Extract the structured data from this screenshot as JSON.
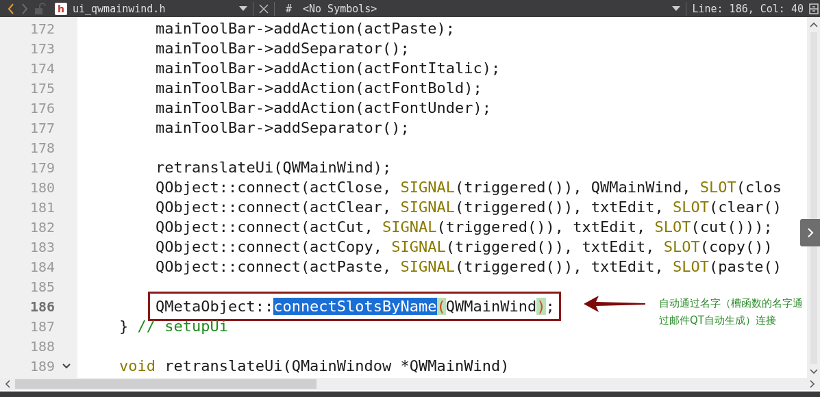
{
  "toolbar": {
    "file_badge": "h",
    "file_name": "ui_qwmainwind.h",
    "symbol_hash": "#",
    "symbols": "<No Symbols>",
    "position": "Line: 186, Col: 40"
  },
  "lines": [
    {
      "number": "172",
      "tokens": [
        {
          "kind": "plain",
          "text": "        mainToolBar->addAction(actPaste);"
        }
      ]
    },
    {
      "number": "173",
      "tokens": [
        {
          "kind": "plain",
          "text": "        mainToolBar->addSeparator();"
        }
      ]
    },
    {
      "number": "174",
      "tokens": [
        {
          "kind": "plain",
          "text": "        mainToolBar->addAction(actFontItalic);"
        }
      ]
    },
    {
      "number": "175",
      "tokens": [
        {
          "kind": "plain",
          "text": "        mainToolBar->addAction(actFontBold);"
        }
      ]
    },
    {
      "number": "176",
      "tokens": [
        {
          "kind": "plain",
          "text": "        mainToolBar->addAction(actFontUnder);"
        }
      ]
    },
    {
      "number": "177",
      "tokens": [
        {
          "kind": "plain",
          "text": "        mainToolBar->addSeparator();"
        }
      ]
    },
    {
      "number": "178"
    },
    {
      "number": "179",
      "tokens": [
        {
          "kind": "plain",
          "text": "        retranslateUi(QWMainWind);"
        }
      ]
    },
    {
      "number": "180",
      "tokens": [
        {
          "kind": "plain",
          "text": "        QObject::connect(actClose, "
        },
        {
          "kind": "macro",
          "text": "SIGNAL"
        },
        {
          "kind": "plain",
          "text": "(triggered()), QWMainWind, "
        },
        {
          "kind": "macro",
          "text": "SLOT"
        },
        {
          "kind": "plain",
          "text": "(clos"
        }
      ]
    },
    {
      "number": "181",
      "tokens": [
        {
          "kind": "plain",
          "text": "        QObject::connect(actClear, "
        },
        {
          "kind": "macro",
          "text": "SIGNAL"
        },
        {
          "kind": "plain",
          "text": "(triggered()), txtEdit, "
        },
        {
          "kind": "macro",
          "text": "SLOT"
        },
        {
          "kind": "plain",
          "text": "(clear()"
        }
      ]
    },
    {
      "number": "182",
      "tokens": [
        {
          "kind": "plain",
          "text": "        QObject::connect(actCut, "
        },
        {
          "kind": "macro",
          "text": "SIGNAL"
        },
        {
          "kind": "plain",
          "text": "(triggered()), txtEdit, "
        },
        {
          "kind": "macro",
          "text": "SLOT"
        },
        {
          "kind": "plain",
          "text": "(cut()));"
        }
      ]
    },
    {
      "number": "183",
      "tokens": [
        {
          "kind": "plain",
          "text": "        QObject::connect(actCopy, "
        },
        {
          "kind": "macro",
          "text": "SIGNAL"
        },
        {
          "kind": "plain",
          "text": "(triggered()), txtEdit, "
        },
        {
          "kind": "macro",
          "text": "SLOT"
        },
        {
          "kind": "plain",
          "text": "(copy())"
        }
      ]
    },
    {
      "number": "184",
      "tokens": [
        {
          "kind": "plain",
          "text": "        QObject::connect(actPaste, "
        },
        {
          "kind": "macro",
          "text": "SIGNAL"
        },
        {
          "kind": "plain",
          "text": "(triggered()), txtEdit, "
        },
        {
          "kind": "macro",
          "text": "SLOT"
        },
        {
          "kind": "plain",
          "text": "(paste()"
        }
      ]
    },
    {
      "number": "185"
    },
    {
      "number": "186",
      "current": true,
      "boxed": true,
      "tokens": [
        {
          "kind": "plain",
          "text": "        QMetaObject::"
        },
        {
          "kind": "selected",
          "text": "connectSlotsByName"
        },
        {
          "kind": "match",
          "text": "("
        },
        {
          "kind": "plain",
          "text": "QWMainWind"
        },
        {
          "kind": "match",
          "text": ")"
        },
        {
          "kind": "plain",
          "text": ";"
        }
      ]
    },
    {
      "number": "187",
      "tokens": [
        {
          "kind": "plain",
          "text": "    } "
        },
        {
          "kind": "comment",
          "text": "// setupUi"
        }
      ]
    },
    {
      "number": "188"
    },
    {
      "number": "189",
      "expanded": true,
      "tokens": [
        {
          "kind": "keyword",
          "text": "    void"
        },
        {
          "kind": "plain",
          "text": " retranslateUi(QMainWindow *QWMainWind)"
        }
      ]
    }
  ],
  "annotation": "自动通过名字（槽函数的名字通过邮件QT自动生成）连接"
}
